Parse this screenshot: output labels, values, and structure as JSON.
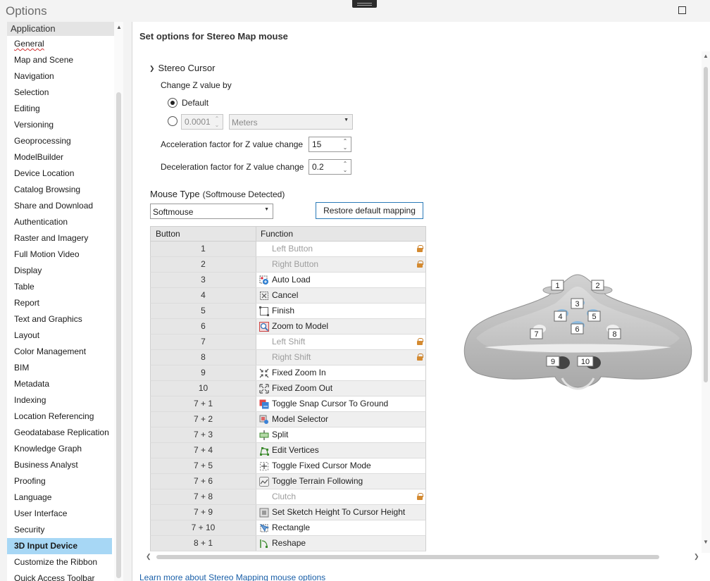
{
  "window": {
    "title": "Options"
  },
  "sidebar": {
    "group": "Application",
    "items": [
      {
        "label": "General",
        "spell": true
      },
      {
        "label": "Map and Scene"
      },
      {
        "label": "Navigation"
      },
      {
        "label": "Selection"
      },
      {
        "label": "Editing"
      },
      {
        "label": "Versioning"
      },
      {
        "label": "Geoprocessing"
      },
      {
        "label": "ModelBuilder"
      },
      {
        "label": "Device Location"
      },
      {
        "label": "Catalog Browsing"
      },
      {
        "label": "Share and Download"
      },
      {
        "label": "Authentication"
      },
      {
        "label": "Raster and Imagery"
      },
      {
        "label": "Full Motion Video"
      },
      {
        "label": "Display"
      },
      {
        "label": "Table"
      },
      {
        "label": "Report"
      },
      {
        "label": "Text and Graphics"
      },
      {
        "label": "Layout"
      },
      {
        "label": "Color Management"
      },
      {
        "label": "BIM"
      },
      {
        "label": "Metadata"
      },
      {
        "label": "Indexing"
      },
      {
        "label": "Location Referencing"
      },
      {
        "label": "Geodatabase Replication"
      },
      {
        "label": "Knowledge Graph"
      },
      {
        "label": "Business Analyst"
      },
      {
        "label": "Proofing"
      },
      {
        "label": "Language"
      },
      {
        "label": "User Interface"
      },
      {
        "label": "Security"
      },
      {
        "label": "3D Input Device",
        "active": true
      },
      {
        "label": "Customize the Ribbon"
      },
      {
        "label": "Quick Access Toolbar"
      }
    ]
  },
  "main": {
    "title": "Set options for Stereo Map mouse",
    "stereo_cursor": {
      "heading": "Stereo Cursor",
      "change_z_label": "Change Z value by",
      "default_label": "Default",
      "custom_value": "0.0001",
      "units": "Meters",
      "accel_label": "Acceleration factor for Z value change",
      "accel_value": "15",
      "decel_label": "Deceleration factor for Z value change",
      "decel_value": "0.2"
    },
    "mouse_type": {
      "heading": "Mouse Type",
      "detected": "(Softmouse Detected)",
      "selected": "Softmouse",
      "restore_label": "Restore default mapping"
    },
    "table": {
      "headers": [
        "Button",
        "Function"
      ],
      "rows": [
        {
          "button": "1",
          "function": "Left Button",
          "locked": true,
          "icon": "none"
        },
        {
          "button": "2",
          "function": "Right Button",
          "locked": true,
          "icon": "none"
        },
        {
          "button": "3",
          "function": "Auto Load",
          "icon": "auto-load-icon"
        },
        {
          "button": "4",
          "function": "Cancel",
          "icon": "cancel-icon"
        },
        {
          "button": "5",
          "function": "Finish",
          "icon": "finish-icon"
        },
        {
          "button": "6",
          "function": "Zoom to Model",
          "icon": "zoom-to-model-icon"
        },
        {
          "button": "7",
          "function": "Left Shift",
          "locked": true,
          "icon": "none"
        },
        {
          "button": "8",
          "function": "Right Shift",
          "locked": true,
          "icon": "none"
        },
        {
          "button": "9",
          "function": "Fixed Zoom In",
          "icon": "fixed-zoom-in-icon"
        },
        {
          "button": "10",
          "function": "Fixed Zoom Out",
          "icon": "fixed-zoom-out-icon"
        },
        {
          "button": "7 + 1",
          "function": "Toggle Snap Cursor To Ground",
          "icon": "snap-cursor-icon"
        },
        {
          "button": "7 + 2",
          "function": "Model Selector",
          "icon": "model-selector-icon"
        },
        {
          "button": "7 + 3",
          "function": "Split",
          "icon": "split-icon"
        },
        {
          "button": "7 + 4",
          "function": "Edit Vertices",
          "icon": "edit-vertices-icon"
        },
        {
          "button": "7 + 5",
          "function": "Toggle Fixed Cursor Mode",
          "icon": "fixed-cursor-icon"
        },
        {
          "button": "7 + 6",
          "function": "Toggle Terrain Following",
          "icon": "terrain-following-icon"
        },
        {
          "button": "7 + 8",
          "function": "Clutch",
          "locked": true,
          "icon": "none"
        },
        {
          "button": "7 + 9",
          "function": "Set Sketch Height To Cursor Height",
          "icon": "sketch-height-icon"
        },
        {
          "button": "7 + 10",
          "function": "Rectangle",
          "icon": "rectangle-icon"
        },
        {
          "button": "8 + 1",
          "function": "Reshape",
          "icon": "reshape-icon"
        }
      ]
    },
    "diagram_labels": [
      "1",
      "2",
      "3",
      "4",
      "5",
      "6",
      "7",
      "8",
      "9",
      "10"
    ],
    "learn_more": "Learn more about Stereo Mapping mouse options"
  },
  "colors": {
    "active_item": "#a7d7f5",
    "link": "#1a5fa8",
    "button_border": "#2a7ab8",
    "lock": "#d48a30"
  }
}
